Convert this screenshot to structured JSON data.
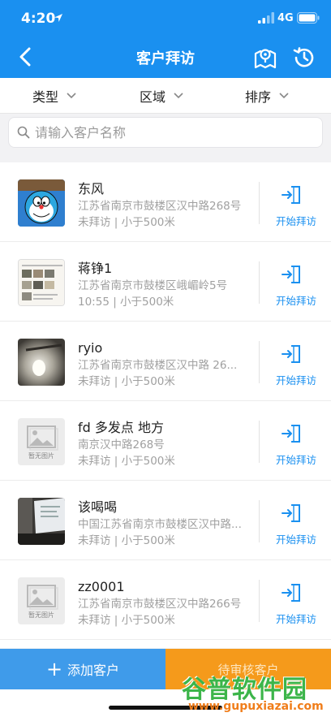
{
  "status_bar": {
    "time": "4:20",
    "network": "4G"
  },
  "nav": {
    "title": "客户拜访"
  },
  "filters": {
    "type": "类型",
    "area": "区域",
    "sort": "排序"
  },
  "search": {
    "placeholder": "请输入客户名称"
  },
  "customers": [
    {
      "name": "东风",
      "address": "江苏省南京市鼓楼区汉中路268号",
      "status": "未拜访 | 小于500米",
      "thumb": "doraemon",
      "action": "开始拜访"
    },
    {
      "name": "蒋铮1",
      "address": "江苏省南京市鼓楼区峨嵋岭5号",
      "status": "10:55 | 小于500米",
      "thumb": "document",
      "action": "开始拜访"
    },
    {
      "name": "ryio",
      "address": "江苏省南京市鼓楼区汉中路 26...",
      "status": "未拜访 | 小于500米",
      "thumb": "light",
      "action": "开始拜访"
    },
    {
      "name": "fd 多发点 地方",
      "address": "南京汉中路268号",
      "status": "未拜访 | 小于500米",
      "thumb": "placeholder",
      "action": "开始拜访"
    },
    {
      "name": "该喝喝",
      "address": "中国江苏省南京市鼓楼区汉中路...",
      "status": "未拜访 | 小于500米",
      "thumb": "screen",
      "action": "开始拜访"
    },
    {
      "name": "zz0001",
      "address": "江苏省南京市鼓楼区汉中路266号",
      "status": "未拜访 | 小于500米",
      "thumb": "placeholder",
      "action": "开始拜访"
    }
  ],
  "placeholder_text": "暂无图片",
  "bottom": {
    "add_label": "添加客户",
    "nearby_label": "待审核客户"
  },
  "watermark": {
    "title": "谷普软件园",
    "url": "www.gupuxiazai.com"
  },
  "colors": {
    "primary": "#1a90f0",
    "add_button": "#3f9bea",
    "nearby_button": "#f59a1b"
  },
  "icons": {
    "back": "chevron-left-icon",
    "map": "map-pin-icon",
    "history": "history-clock-icon",
    "visit": "sign-in-icon",
    "search": "search-icon"
  }
}
